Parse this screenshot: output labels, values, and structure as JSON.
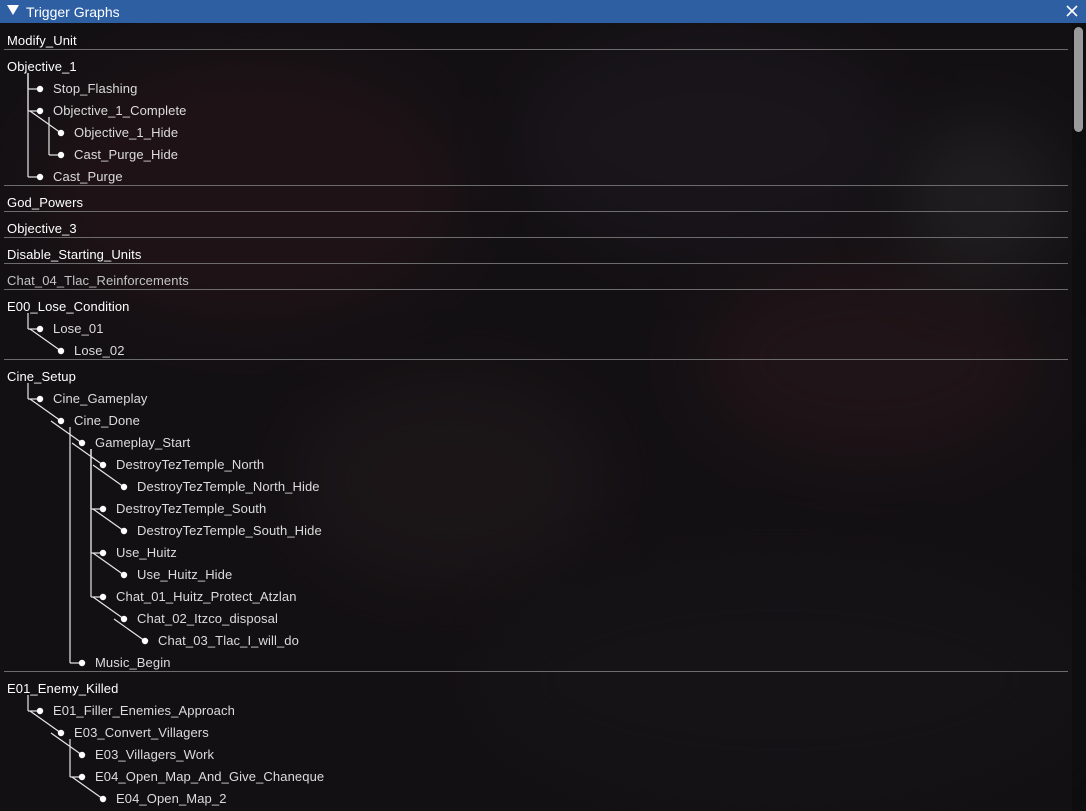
{
  "window": {
    "title": "Trigger Graphs"
  },
  "groups": [
    {
      "root": "Modify_Unit",
      "children": []
    },
    {
      "root": "Objective_1",
      "children": [
        {
          "label": "Stop_Flashing",
          "depth": 1
        },
        {
          "label": "Objective_1_Complete",
          "depth": 1
        },
        {
          "label": "Objective_1_Hide",
          "depth": 2
        },
        {
          "label": "Cast_Purge_Hide",
          "depth": 2
        },
        {
          "label": "Cast_Purge",
          "depth": 1
        }
      ]
    },
    {
      "root": "God_Powers",
      "children": []
    },
    {
      "root": "Objective_3",
      "children": []
    },
    {
      "root": "Disable_Starting_Units",
      "children": []
    },
    {
      "root": "Chat_04_Tlac_Reinforcements",
      "children": []
    },
    {
      "root": "E00_Lose_Condition",
      "children": [
        {
          "label": "Lose_01",
          "depth": 1
        },
        {
          "label": "Lose_02",
          "depth": 2
        }
      ]
    },
    {
      "root": "Cine_Setup",
      "children": [
        {
          "label": "Cine_Gameplay",
          "depth": 1
        },
        {
          "label": "Cine_Done",
          "depth": 2
        },
        {
          "label": "Gameplay_Start",
          "depth": 3
        },
        {
          "label": "DestroyTezTemple_North",
          "depth": 4
        },
        {
          "label": "DestroyTezTemple_North_Hide",
          "depth": 5
        },
        {
          "label": "DestroyTezTemple_South",
          "depth": 4
        },
        {
          "label": "DestroyTezTemple_South_Hide",
          "depth": 5
        },
        {
          "label": "Use_Huitz",
          "depth": 4
        },
        {
          "label": "Use_Huitz_Hide",
          "depth": 5
        },
        {
          "label": "Chat_01_Huitz_Protect_Atzlan",
          "depth": 4
        },
        {
          "label": "Chat_02_Itzco_disposal",
          "depth": 5
        },
        {
          "label": "Chat_03_Tlac_I_will_do",
          "depth": 6
        },
        {
          "label": "Music_Begin",
          "depth": 3
        }
      ]
    },
    {
      "root": "E01_Enemy_Killed",
      "children": [
        {
          "label": "E01_Filler_Enemies_Approach",
          "depth": 1
        },
        {
          "label": "E03_Convert_Villagers",
          "depth": 2
        },
        {
          "label": "E03_Villagers_Work",
          "depth": 3
        },
        {
          "label": "E04_Open_Map_And_Give_Chaneque",
          "depth": 3
        },
        {
          "label": "E04_Open_Map_2",
          "depth": 4
        }
      ]
    }
  ]
}
